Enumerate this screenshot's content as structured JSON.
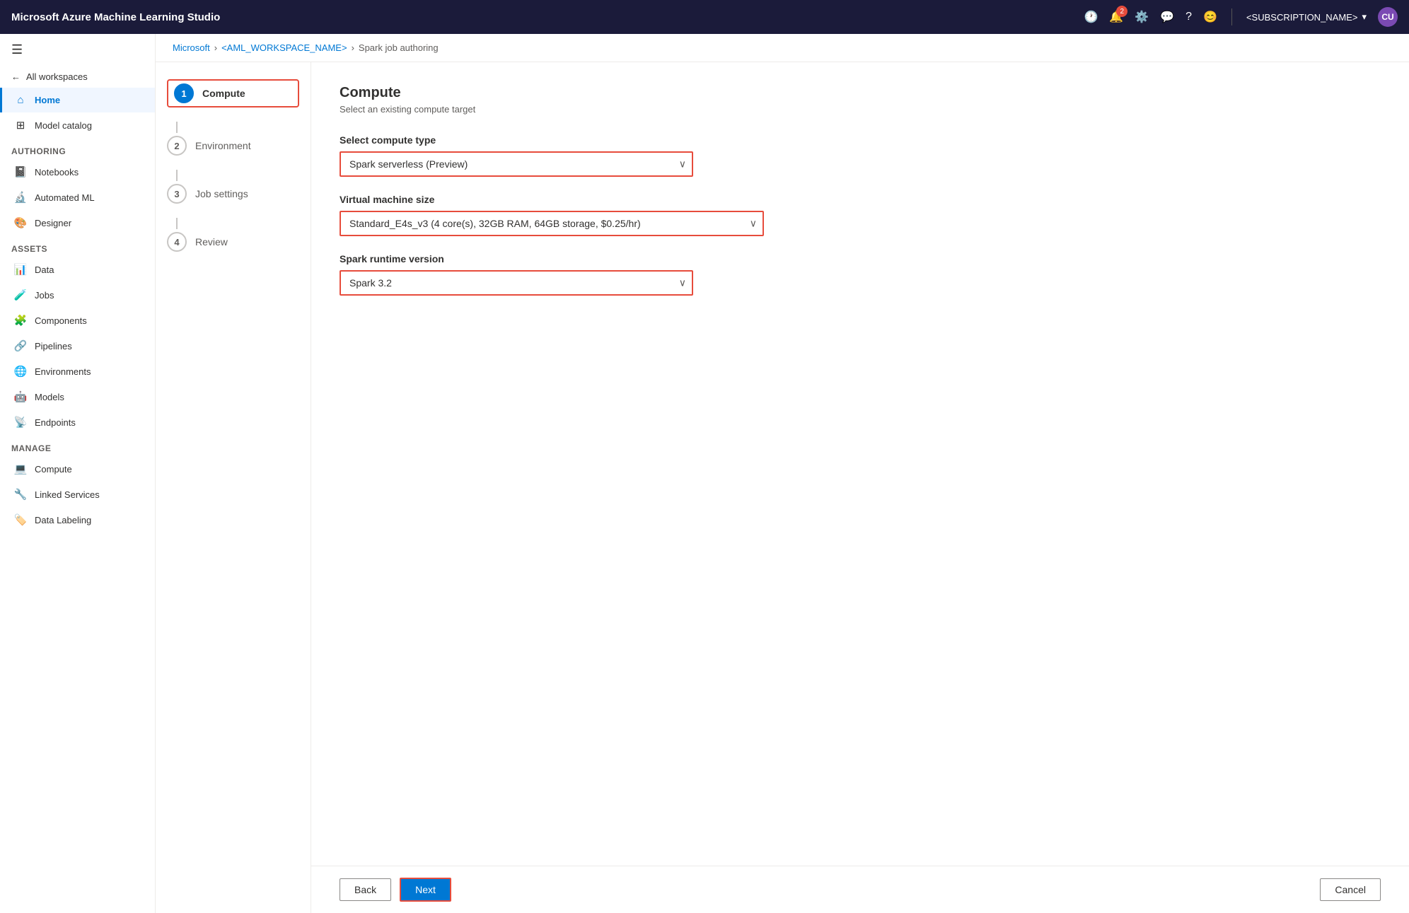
{
  "topbar": {
    "title": "Microsoft Azure Machine Learning Studio",
    "notification_count": "2",
    "account_name": "<SUBSCRIPTION_NAME>",
    "avatar_label": "CU"
  },
  "breadcrumb": {
    "microsoft": "Microsoft",
    "workspace": "<AML_WORKSPACE_NAME>",
    "page": "Spark job authoring"
  },
  "sidebar": {
    "back_label": "All workspaces",
    "items_top": [
      {
        "id": "home",
        "label": "Home",
        "icon": "⌂",
        "active": true
      }
    ],
    "section_authoring": "Authoring",
    "items_authoring": [
      {
        "id": "notebooks",
        "label": "Notebooks",
        "icon": "📓"
      },
      {
        "id": "automated-ml",
        "label": "Automated ML",
        "icon": "🔬"
      },
      {
        "id": "designer",
        "label": "Designer",
        "icon": "🎨"
      }
    ],
    "section_assets": "Assets",
    "items_assets": [
      {
        "id": "data",
        "label": "Data",
        "icon": "📊"
      },
      {
        "id": "jobs",
        "label": "Jobs",
        "icon": "🧪"
      },
      {
        "id": "components",
        "label": "Components",
        "icon": "🧩"
      },
      {
        "id": "pipelines",
        "label": "Pipelines",
        "icon": "🔗"
      },
      {
        "id": "environments",
        "label": "Environments",
        "icon": "🌐"
      },
      {
        "id": "models",
        "label": "Models",
        "icon": "🤖"
      },
      {
        "id": "endpoints",
        "label": "Endpoints",
        "icon": "📡"
      }
    ],
    "section_manage": "Manage",
    "items_manage": [
      {
        "id": "compute",
        "label": "Compute",
        "icon": "💻"
      },
      {
        "id": "linked-services",
        "label": "Linked Services",
        "icon": "🔧"
      },
      {
        "id": "data-labeling",
        "label": "Data Labeling",
        "icon": "🏷️"
      }
    ]
  },
  "wizard": {
    "steps": [
      {
        "number": "1",
        "label": "Compute",
        "active": true
      },
      {
        "number": "2",
        "label": "Environment",
        "active": false
      },
      {
        "number": "3",
        "label": "Job settings",
        "active": false
      },
      {
        "number": "4",
        "label": "Review",
        "active": false
      }
    ]
  },
  "form": {
    "title": "Compute",
    "subtitle": "Select an existing compute target",
    "compute_type_label": "Select compute type",
    "compute_type_value": "Spark serverless (Preview)",
    "compute_type_options": [
      "Spark serverless (Preview)"
    ],
    "vm_size_label": "Virtual machine size",
    "vm_size_value": "Standard_E4s_v3 (4 core(s), 32GB RAM, 64GB storage, $0.25/hr)",
    "vm_size_options": [
      "Standard_E4s_v3 (4 core(s), 32GB RAM, 64GB storage, $0.25/hr)"
    ],
    "spark_runtime_label": "Spark runtime version",
    "spark_runtime_value": "Spark 3.2",
    "spark_runtime_options": [
      "Spark 3.2"
    ]
  },
  "buttons": {
    "back": "Back",
    "next": "Next",
    "cancel": "Cancel"
  }
}
